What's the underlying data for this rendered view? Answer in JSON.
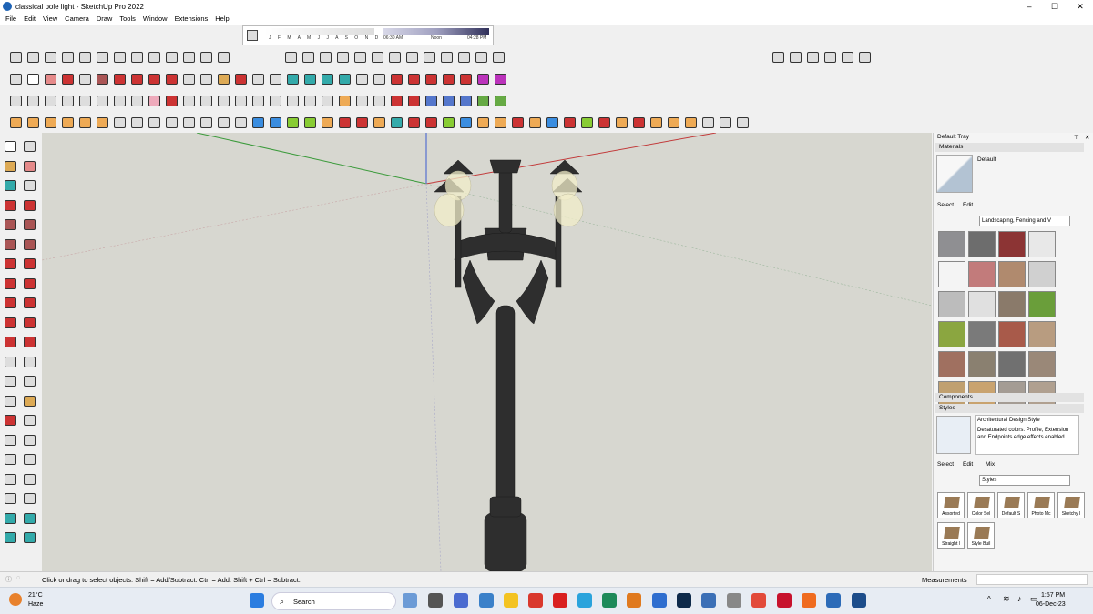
{
  "window": {
    "title": "classical pole light - SketchUp Pro 2022",
    "minimize": "–",
    "maximize": "☐",
    "close": "✕"
  },
  "menu": [
    "File",
    "Edit",
    "View",
    "Camera",
    "Draw",
    "Tools",
    "Window",
    "Extensions",
    "Help"
  ],
  "shadow": {
    "months": "J F M A M J J A S O N D",
    "time_start": "06:30 AM",
    "time_mid": "Noon",
    "time_end": "04:28 PM"
  },
  "tray": {
    "title": "Default Tray",
    "pin": "⊤",
    "close": "✕",
    "materials": {
      "header": "Materials",
      "current": "Default",
      "select_tab": "Select",
      "edit_tab": "Edit",
      "collection": "Landscaping, Fencing and V",
      "swatches": [
        "#8f8f92",
        "#6d6d6d",
        "#8c3434",
        "#e8e8e8",
        "#f4f4f4",
        "#c27b7b",
        "#b08a6e",
        "#d0d0d0",
        "#bcbcbc",
        "#e0e0e0",
        "#8a7a6a",
        "#6a9e3a",
        "#8ba640",
        "#7a7a7a",
        "#a85a4a",
        "#b89c80",
        "#a07060",
        "#8a8070",
        "#707070",
        "#9a8878",
        "#c0a070",
        "#c9a36f",
        "#a49c94",
        "#b0a090"
      ]
    },
    "components": {
      "header": "Components"
    },
    "styles": {
      "header": "Styles",
      "name": "Architectural Design Style",
      "description": "Desaturated colors. Profile, Extension and Endpoints edge effects enabled.",
      "select_tab": "Select",
      "edit_tab": "Edit",
      "mix_tab": "Mix",
      "collection": "Styles",
      "items": [
        "Assorted",
        "Color Sel",
        "Default S",
        "Photo Mc",
        "Sketchy I",
        "Straight l",
        "Style Buil"
      ]
    }
  },
  "status": {
    "text": "Click or drag to select objects. Shift = Add/Subtract. Ctrl = Add. Shift + Ctrl = Subtract.",
    "measurements": "Measurements"
  },
  "taskbar": {
    "temperature": "21°C",
    "weather": "Haze",
    "search": "Search",
    "time": "1:57 PM",
    "date": "06-Dec-23"
  },
  "colors": {
    "viewport_bg": "#d7d7d0",
    "lamp_dark": "#2e2e2e",
    "axis_red": "#c23b3b",
    "axis_green": "#3a9a3a",
    "axis_blue": "#3b5bd0"
  }
}
